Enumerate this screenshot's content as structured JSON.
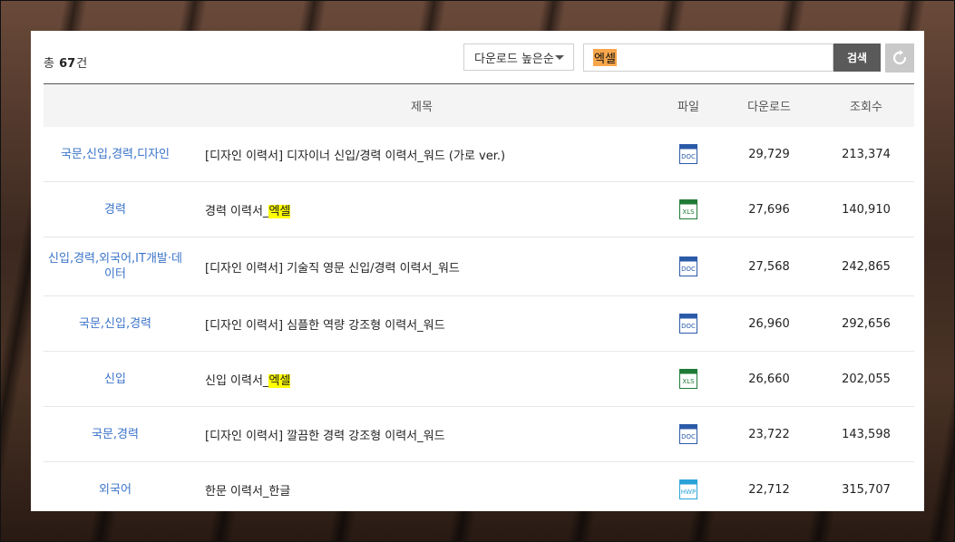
{
  "summary": {
    "prefix": "총",
    "count": "67",
    "suffix": "건"
  },
  "sort": {
    "label": "다운로드 높은순"
  },
  "search": {
    "value": "엑셀",
    "button": "검색"
  },
  "table": {
    "headers": {
      "title": "제목",
      "file": "파일",
      "downloads": "다운로드",
      "views": "조회수"
    },
    "rows": [
      {
        "category": "국문,신입,경력,디자인",
        "title": "[디자인 이력서] 디자이너 신입/경력 이력서_워드 (가로 ver.)",
        "title_highlight": "",
        "file_type": "DOC",
        "downloads": "29,729",
        "views": "213,374"
      },
      {
        "category": "경력",
        "title": "경력 이력서_",
        "title_highlight": "엑셀",
        "file_type": "XLS",
        "downloads": "27,696",
        "views": "140,910"
      },
      {
        "category": "신입,경력,외국어,IT개발·데이터",
        "title": "[디자인 이력서] 기술직 영문 신입/경력 이력서_워드",
        "title_highlight": "",
        "file_type": "DOC",
        "downloads": "27,568",
        "views": "242,865"
      },
      {
        "category": "국문,신입,경력",
        "title": "[디자인 이력서] 심플한 역량 강조형 이력서_워드",
        "title_highlight": "",
        "file_type": "DOC",
        "downloads": "26,960",
        "views": "292,656"
      },
      {
        "category": "신입",
        "title": "신입 이력서_",
        "title_highlight": "엑셀",
        "file_type": "XLS",
        "downloads": "26,660",
        "views": "202,055"
      },
      {
        "category": "국문,경력",
        "title": "[디자인 이력서] 깔끔한 경력 강조형 이력서_워드",
        "title_highlight": "",
        "file_type": "DOC",
        "downloads": "23,722",
        "views": "143,598"
      },
      {
        "category": "외국어",
        "title": "한문 이력서_한글",
        "title_highlight": "",
        "file_type": "HWP",
        "downloads": "22,712",
        "views": "315,707"
      }
    ]
  },
  "file_colors": {
    "DOC": "#2b5aa8",
    "XLS": "#1f7a36",
    "HWP": "#2aa2d8"
  },
  "icons": {
    "sort": "chevron-down-icon",
    "reset": "refresh-icon"
  }
}
